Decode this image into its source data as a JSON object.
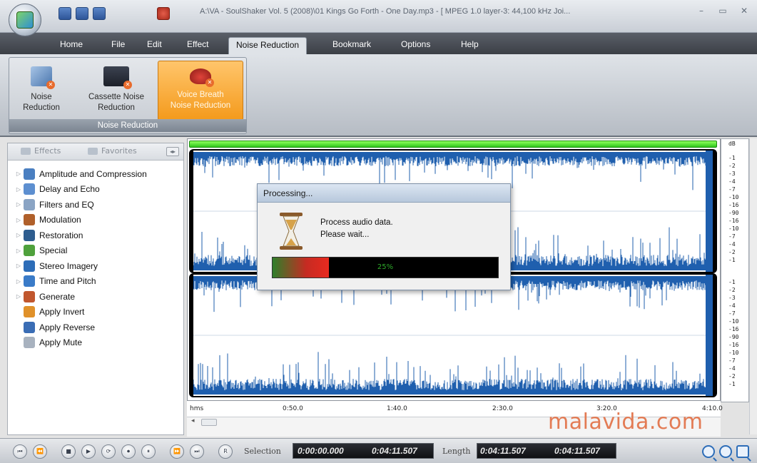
{
  "window": {
    "title": "A:\\VA - SoulShaker Vol. 5 (2008)\\01 Kings Go Forth - One Day.mp3 - [ MPEG 1.0 layer-3: 44,100 kHz Joi...",
    "controls": [
      "–",
      "▭",
      "✕"
    ]
  },
  "menu": {
    "tabs": [
      "Home",
      "File",
      "Edit",
      "Effect",
      "Noise Reduction",
      "Bookmark",
      "Options",
      "Help"
    ],
    "active": "Noise Reduction"
  },
  "ribbon": {
    "group_label": "Noise Reduction",
    "buttons": [
      {
        "line1": "Noise",
        "line2": "Reduction",
        "icon": "noise-reduction-icon"
      },
      {
        "line1": "Cassette Noise",
        "line2": "Reduction",
        "icon": "cassette-icon"
      },
      {
        "line1": "Voice Breath",
        "line2": "Noise Reduction",
        "icon": "lips-icon"
      }
    ]
  },
  "left_panel": {
    "tab_effects": "Effects",
    "tab_favorites": "Favorites",
    "items": [
      {
        "label": "Amplitude and Compression",
        "expandable": true,
        "color": "#4a7fc1"
      },
      {
        "label": "Delay and Echo",
        "expandable": true,
        "color": "#5d8fd0"
      },
      {
        "label": "Filters and EQ",
        "expandable": true,
        "color": "#8aa4c4"
      },
      {
        "label": "Modulation",
        "expandable": true,
        "color": "#b0602a"
      },
      {
        "label": "Restoration",
        "expandable": true,
        "color": "#2e5d8f"
      },
      {
        "label": "Special",
        "expandable": true,
        "color": "#4fa13c"
      },
      {
        "label": "Stereo Imagery",
        "expandable": true,
        "color": "#2d6db8"
      },
      {
        "label": "Time and Pitch",
        "expandable": true,
        "color": "#3a7bc8"
      },
      {
        "label": "Generate",
        "expandable": true,
        "color": "#c1572e"
      },
      {
        "label": "Apply Invert",
        "expandable": false,
        "color": "#e0912a"
      },
      {
        "label": "Apply Reverse",
        "expandable": false,
        "color": "#3a6db5"
      },
      {
        "label": "Apply Mute",
        "expandable": false,
        "color": "#a8b2bf"
      }
    ]
  },
  "timeline": {
    "labels": [
      "hms",
      "0:50.0",
      "1:40.0",
      "2:30.0",
      "3:20.0",
      "4:10.0"
    ]
  },
  "db_scale": {
    "unit": "dB",
    "channel1": [
      "-1",
      "-2",
      "-3",
      "-4",
      "-7",
      "-10",
      "-16",
      "-90",
      "-16",
      "-10",
      "-7",
      "-4",
      "-2",
      "-1"
    ],
    "channel2": [
      "-1",
      "-2",
      "-3",
      "-4",
      "-7",
      "-10",
      "-16",
      "-90",
      "-16",
      "-10",
      "-7",
      "-4",
      "-2",
      "-1"
    ]
  },
  "dialog": {
    "title": "Processing...",
    "message_line1": "Process audio data.",
    "message_line2": "Please wait...",
    "progress": 0.25,
    "progress_label": "25%"
  },
  "transport": {
    "buttons": [
      "⏮",
      "⏪",
      "■",
      "▶",
      "⟳",
      "⏺",
      "⏸",
      "⏩",
      "⏭",
      "R"
    ],
    "selection_label": "Selection",
    "selection_start": "0:00:00.000",
    "selection_end": "0:04:11.507",
    "length_label": "Length",
    "length_start": "0:04:11.507",
    "length_end": "0:04:11.507"
  },
  "watermark": "malavida.com",
  "colors": {
    "waveform": "#1f5fae",
    "progress_green": "#2f7f2a",
    "progress_red": "#e82a1f",
    "ribbon_active": "#f49a1c"
  }
}
